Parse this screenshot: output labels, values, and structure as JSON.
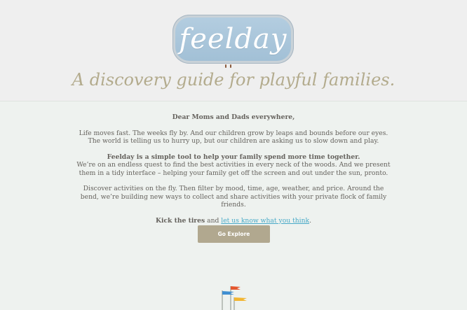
{
  "logo": {
    "text": "feelday"
  },
  "header": {
    "tagline": "A discovery guide for playful families."
  },
  "letter": {
    "salutation": "Dear Moms and Dads everywhere,",
    "para1": "Life moves fast. The weeks fly by. And our children grow by leaps and bounds before our eyes. The world is telling us to hurry up, but our children are asking us to slow down and play.",
    "para2_bold": "Feelday is a simple tool to help your family spend more time together.",
    "para2": "We’re on an endless quest to find the best activities in every neck of the woods. And we present them in a tidy interface – helping your family get off the screen and out under the sun, pronto.",
    "para3": "Discover activities on the fly. Then filter by mood, time, age, weather, and price. Around the bend, we’re building new ways to collect and share activities with your private flock of family friends.",
    "kick_bold": "Kick the tires",
    "kick_and": " and ",
    "kick_link": "let us know what you think",
    "kick_period": "."
  },
  "cta": {
    "label": "Go Explore"
  },
  "colors": {
    "accent": "#b1a88f",
    "link": "#47a9c7",
    "logo_bg": "#a9c6da",
    "flag_red": "#e4572e",
    "flag_blue": "#3f8fd1",
    "flag_yellow": "#f2b632"
  },
  "icons": {
    "flags": "flags-icon"
  }
}
